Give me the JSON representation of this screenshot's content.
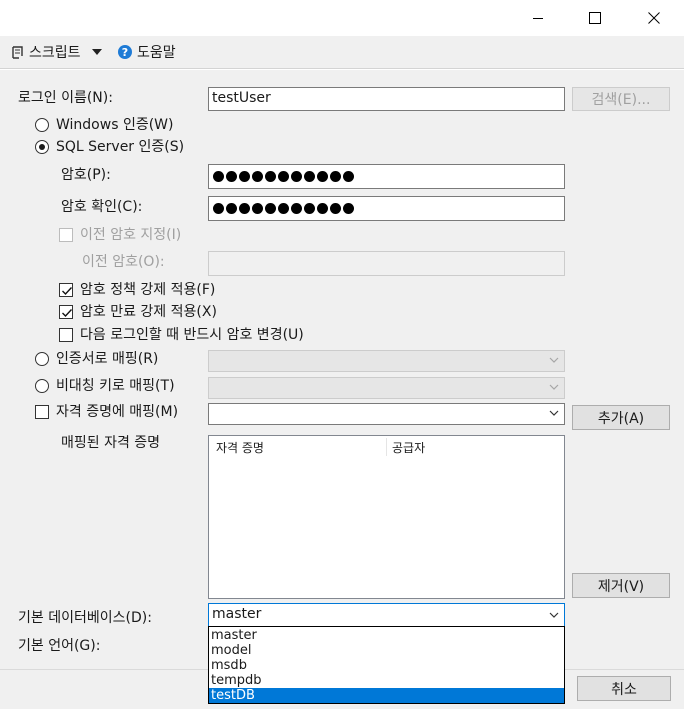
{
  "toolbar": {
    "script_label": "스크립트",
    "help_label": "도움말"
  },
  "form": {
    "login_name_label": "로그인 이름(N):",
    "login_name_value": "testUser",
    "search_button": "검색(E)...",
    "windows_auth_label": "Windows 인증(W)",
    "sql_auth_label": "SQL Server 인증(S)",
    "password_label": "암호(P):",
    "confirm_password_label": "암호 확인(C):",
    "password_dot_count": 11,
    "specify_old_password_label": "이전 암호 지정(I)",
    "old_password_label": "이전 암호(O):",
    "enforce_policy_label": "암호 정책 강제 적용(F)",
    "enforce_expiration_label": "암호 만료 강제 적용(X)",
    "must_change_label": "다음 로그인할 때 반드시 암호 변경(U)",
    "cert_mapped_label": "인증서로 매핑(R)",
    "asym_key_mapped_label": "비대칭 키로 매핑(T)",
    "credential_mapped_label": "자격 증명에 매핑(M)",
    "add_button": "추가(A)",
    "mapped_credentials_label": "매핑된 자격 증명",
    "credentials_columns": [
      "자격 증명",
      "공급자"
    ],
    "remove_button": "제거(V)",
    "default_database_label": "기본 데이터베이스(D):",
    "default_database_value": "master",
    "default_language_label": "기본 언어(G):"
  },
  "database_dropdown": {
    "options": [
      "master",
      "model",
      "msdb",
      "tempdb",
      "testDB"
    ],
    "highlighted": "testDB"
  },
  "footer": {
    "cancel_button": "취소"
  },
  "colors": {
    "selection": "#0078d7",
    "help_icon": "#1e7bd6"
  }
}
